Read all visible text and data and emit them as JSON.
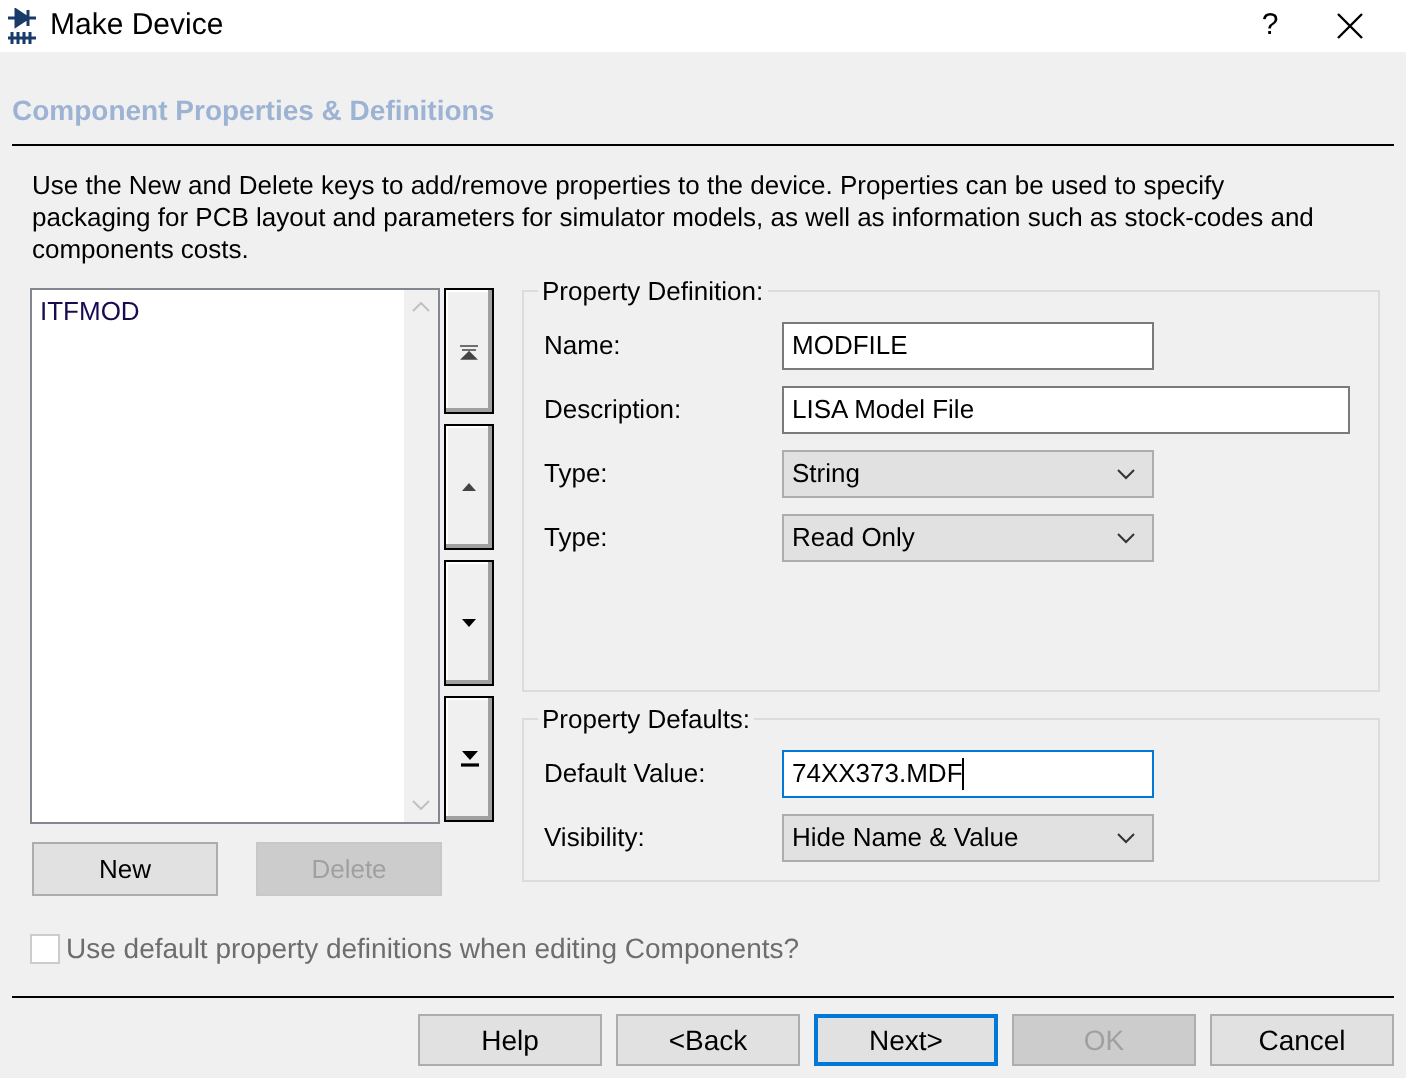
{
  "window": {
    "title": "Make Device",
    "help": "?"
  },
  "heading": "Component Properties & Definitions",
  "description": "Use the New and Delete keys to add/remove properties to the device. Properties can be used to specify packaging for PCB layout and parameters for simulator models, as well as information such as stock-codes and components costs.",
  "property_list": {
    "items": [
      {
        "label": "ITFMOD",
        "selected": false
      }
    ]
  },
  "list_buttons": [
    {
      "label": "New",
      "disabled": false
    },
    {
      "label": "Delete",
      "disabled": true
    }
  ],
  "property_definition": {
    "title": "Property Definition:",
    "fields": [
      {
        "kind": "text",
        "label": "Name:",
        "value": "MODFILE",
        "wide": false,
        "focused": false
      },
      {
        "kind": "text",
        "label": "Description:",
        "value": "LISA Model File",
        "wide": true,
        "focused": false
      },
      {
        "kind": "select",
        "label": "Type:",
        "value": "String"
      },
      {
        "kind": "select",
        "label": "Type:",
        "value": "Read Only"
      }
    ]
  },
  "property_defaults": {
    "title": "Property Defaults:",
    "fields": [
      {
        "kind": "text",
        "label": "Default Value:",
        "value": "74XX373.MDF",
        "wide": false,
        "focused": true
      },
      {
        "kind": "select",
        "label": "Visibility:",
        "value": "Hide Name & Value"
      }
    ]
  },
  "use_defaults": {
    "label": "Use default property definitions when editing Components?",
    "checked": false,
    "disabled": true
  },
  "buttons": [
    {
      "label": "Help",
      "disabled": false,
      "focused": false
    },
    {
      "label": "<Back",
      "disabled": false,
      "focused": false
    },
    {
      "label": "Next>",
      "disabled": false,
      "focused": true
    },
    {
      "label": "OK",
      "disabled": true,
      "focused": false
    },
    {
      "label": "Cancel",
      "disabled": false,
      "focused": false
    }
  ]
}
